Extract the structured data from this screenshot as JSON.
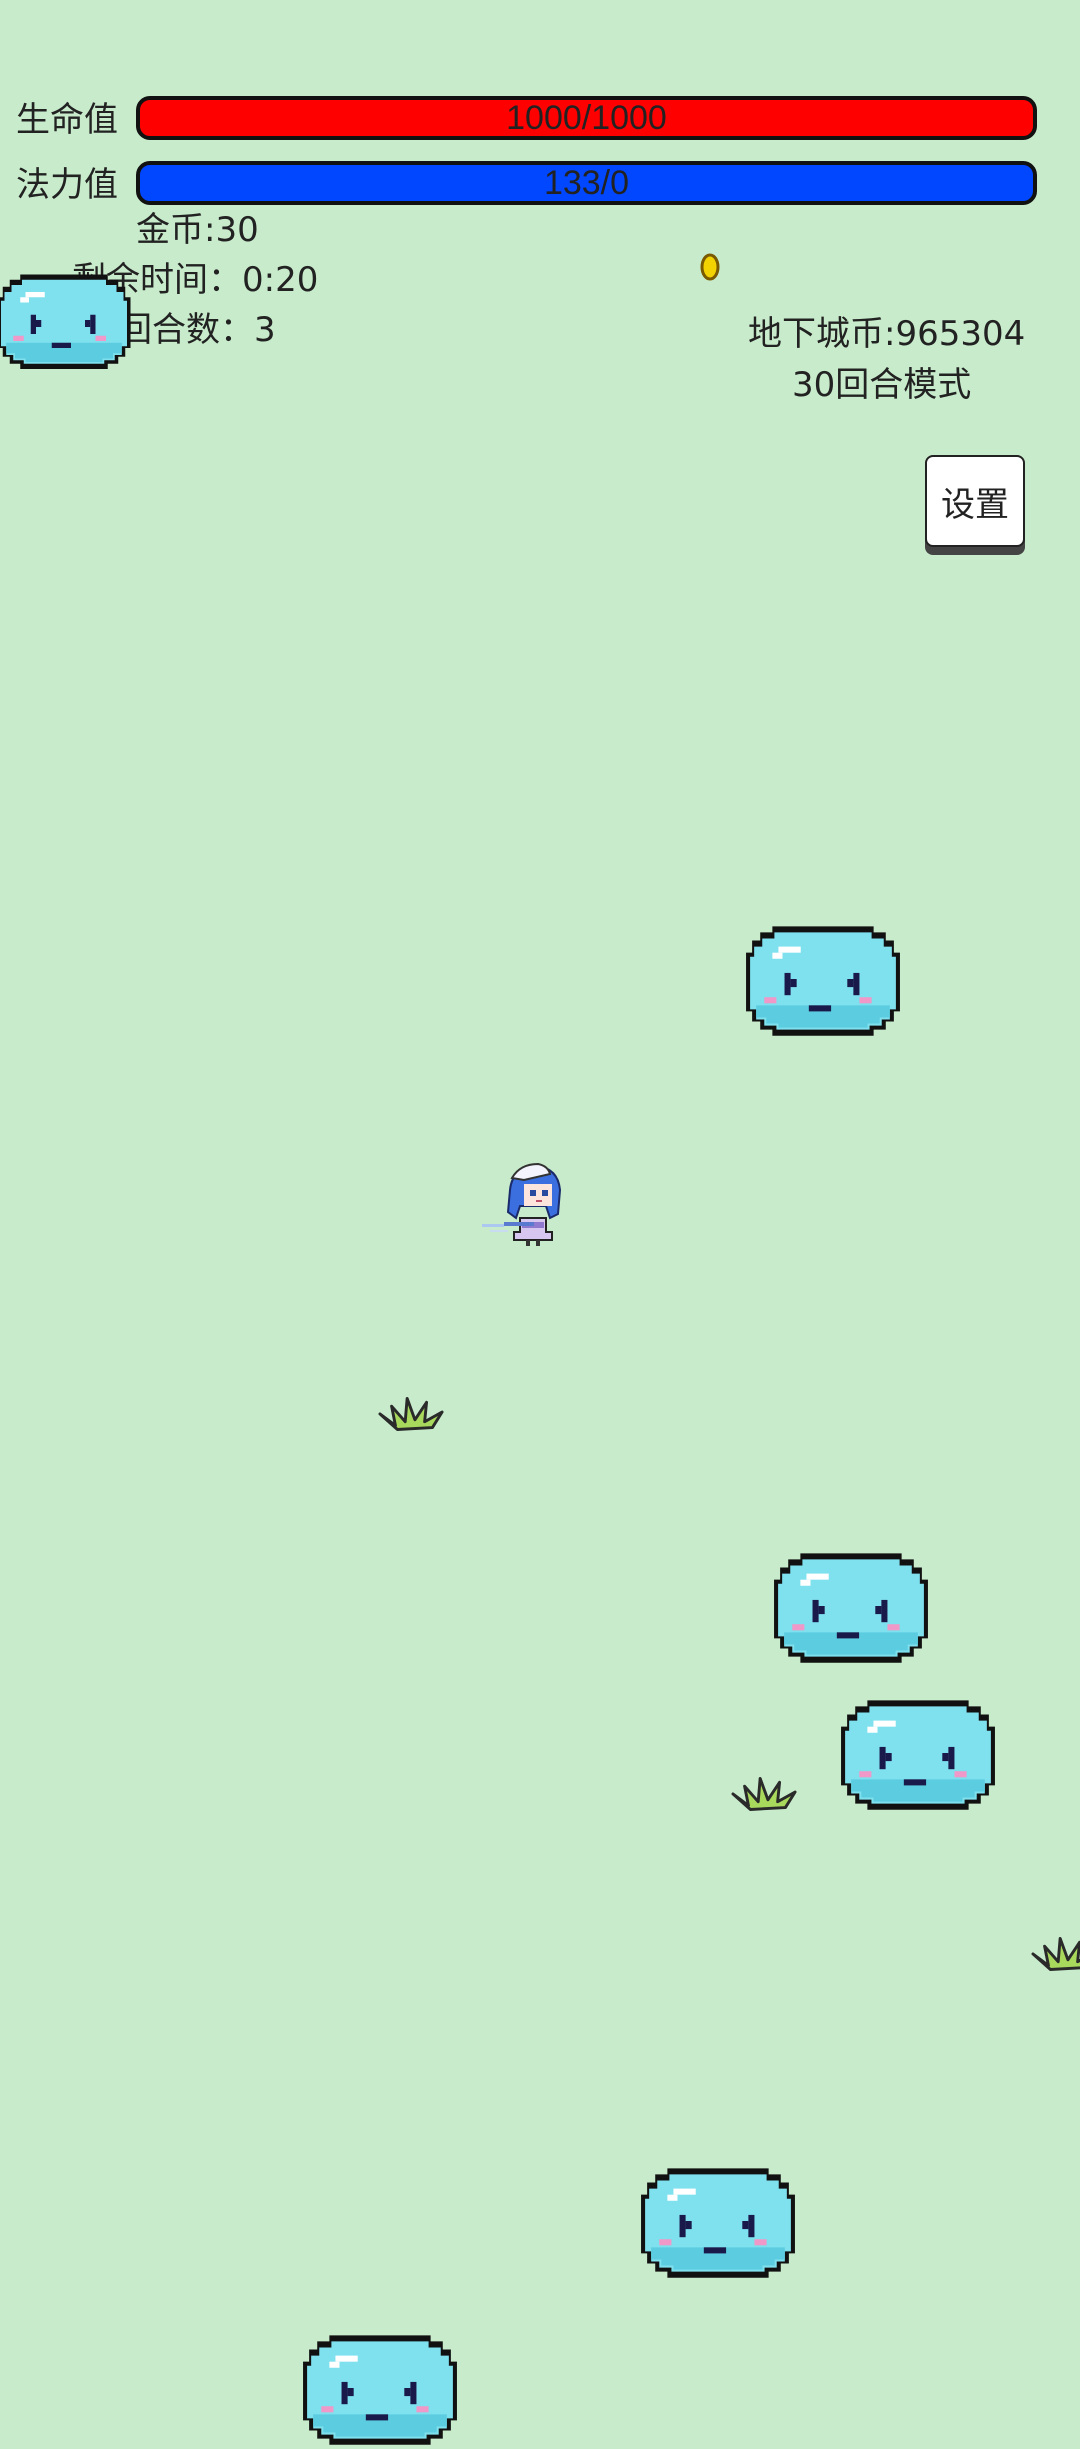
{
  "hud": {
    "hp_label": "生命值",
    "hp_value": "1000/1000",
    "hp_fraction": 1.0,
    "hp_color": "#ff0000",
    "mp_label": "法力值",
    "mp_value": "133/0",
    "mp_color": "#0047ff",
    "gold": "金币:30",
    "time_left": "剩余时间：0:20",
    "round": "回合数：3",
    "dungeon_coins": "地下城币:965304",
    "mode": "30回合模式",
    "settings_label": "设置"
  },
  "entities": {
    "player": "blue-haired-girl-sprite",
    "enemies": "cyan-slime",
    "pickup": "gold-coin",
    "decor": "grass-tuft"
  },
  "colors": {
    "background": "#c8eccb",
    "slime_fill": "#7fe0ee",
    "slime_outline": "#111111"
  }
}
